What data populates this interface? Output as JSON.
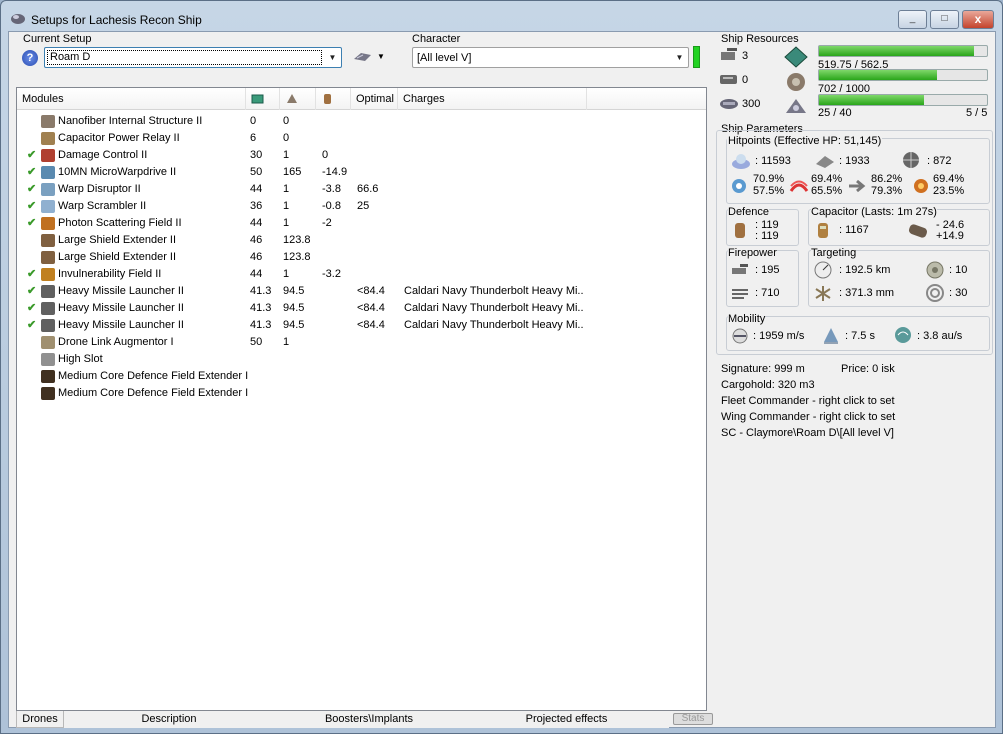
{
  "window": {
    "title": "Setups for Lachesis Recon Ship",
    "min": "_",
    "max": "□",
    "close": "x"
  },
  "setup": {
    "label": "Current Setup",
    "value": "Roam D"
  },
  "character": {
    "label": "Character",
    "value": "[All level V]"
  },
  "modules": {
    "headers": [
      "Modules",
      "Optimal",
      "Charges"
    ],
    "rows": [
      {
        "check": "",
        "name": "Nanofiber Internal Structure II",
        "c1": "0",
        "c2": "0",
        "c3": "",
        "opt": "",
        "charge": "",
        "color": "#8a7a6a"
      },
      {
        "check": "",
        "name": "Capacitor Power Relay II",
        "c1": "6",
        "c2": "0",
        "c3": "",
        "opt": "",
        "charge": "",
        "color": "#a08050"
      },
      {
        "check": "✔",
        "name": "Damage Control II",
        "c1": "30",
        "c2": "1",
        "c3": "0",
        "opt": "",
        "charge": "",
        "color": "#b04030"
      },
      {
        "check": "✔",
        "name": "10MN MicroWarpdrive II",
        "c1": "50",
        "c2": "165",
        "c3": "-14.9",
        "opt": "",
        "charge": "",
        "color": "#5a8ab0"
      },
      {
        "check": "✔",
        "name": "Warp Disruptor II",
        "c1": "44",
        "c2": "1",
        "c3": "-3.8",
        "opt": "66.6",
        "charge": "",
        "color": "#7aa0c0"
      },
      {
        "check": "✔",
        "name": "Warp Scrambler II",
        "c1": "36",
        "c2": "1",
        "c3": "-0.8",
        "opt": "25",
        "charge": "",
        "color": "#90b0d0"
      },
      {
        "check": "✔",
        "name": "Photon Scattering Field II",
        "c1": "44",
        "c2": "1",
        "c3": "-2",
        "opt": "",
        "charge": "",
        "color": "#c07020"
      },
      {
        "check": "",
        "name": "Large Shield Extender II",
        "c1": "46",
        "c2": "123.8",
        "c3": "",
        "opt": "",
        "charge": "",
        "color": "#806040"
      },
      {
        "check": "",
        "name": "Large Shield Extender II",
        "c1": "46",
        "c2": "123.8",
        "c3": "",
        "opt": "",
        "charge": "",
        "color": "#806040"
      },
      {
        "check": "✔",
        "name": "Invulnerability Field II",
        "c1": "44",
        "c2": "1",
        "c3": "-3.2",
        "opt": "",
        "charge": "",
        "color": "#c08020"
      },
      {
        "check": "✔",
        "name": "Heavy Missile Launcher II",
        "c1": "41.3",
        "c2": "94.5",
        "c3": "",
        "opt": "<84.4",
        "charge": "Caldari Navy Thunderbolt Heavy Mi...",
        "color": "#606060"
      },
      {
        "check": "✔",
        "name": "Heavy Missile Launcher II",
        "c1": "41.3",
        "c2": "94.5",
        "c3": "",
        "opt": "<84.4",
        "charge": "Caldari Navy Thunderbolt Heavy Mi...",
        "color": "#606060"
      },
      {
        "check": "✔",
        "name": "Heavy Missile Launcher II",
        "c1": "41.3",
        "c2": "94.5",
        "c3": "",
        "opt": "<84.4",
        "charge": "Caldari Navy Thunderbolt Heavy Mi...",
        "color": "#606060"
      },
      {
        "check": "",
        "name": "Drone Link Augmentor I",
        "c1": "50",
        "c2": "1",
        "c3": "",
        "opt": "",
        "charge": "",
        "color": "#a09070"
      },
      {
        "check": "",
        "name": "High Slot",
        "c1": "",
        "c2": "",
        "c3": "",
        "opt": "",
        "charge": "",
        "color": "#909090"
      },
      {
        "check": "",
        "name": "Medium Core Defence Field Extender I",
        "c1": "",
        "c2": "",
        "c3": "",
        "opt": "",
        "charge": "",
        "color": "#403020"
      },
      {
        "check": "",
        "name": "Medium Core Defence Field Extender I",
        "c1": "",
        "c2": "",
        "c3": "",
        "opt": "",
        "charge": "",
        "color": "#403020"
      }
    ]
  },
  "tabs": [
    "Drones",
    "Description",
    "Boosters\\Implants",
    "Projected effects",
    "Stats"
  ],
  "resources": {
    "title": "Ship Resources",
    "slots": [
      "3",
      "0",
      "300"
    ],
    "bars": [
      {
        "label": "519.75 / 562.5",
        "fill": 0.924
      },
      {
        "label": "702 / 1000",
        "fill": 0.702
      },
      {
        "label": "25 / 40",
        "right": "5 / 5",
        "fill": 0.625
      }
    ]
  },
  "params": {
    "title": "Ship Parameters",
    "hp_title": "Hitpoints (Effective HP: 51,145)",
    "hp": [
      ": 11593",
      ": 1933",
      ": 872"
    ],
    "resists": [
      [
        "70.9%",
        "57.5%"
      ],
      [
        "69.4%",
        "65.5%"
      ],
      [
        "86.2%",
        "79.3%"
      ],
      [
        "69.4%",
        "23.5%"
      ]
    ],
    "defence": {
      "title": "Defence",
      "a": ": 119",
      "b": ": 119"
    },
    "capacitor": {
      "title": "Capacitor (Lasts: 1m 27s)",
      "val": ": 1167",
      "a": "- 24.6",
      "b": "+14.9"
    },
    "firepower": {
      "title": "Firepower",
      "a": ": 195",
      "b": ": 710"
    },
    "targeting": {
      "title": "Targeting",
      "range": ": 192.5 km",
      "targets": ": 10",
      "sig": ": 371.3 mm",
      "scan": ": 30"
    },
    "mobility": {
      "title": "Mobility",
      "speed": ": 1959 m/s",
      "align": ": 7.5 s",
      "warp": ": 3.8 au/s"
    },
    "info": [
      "Signature: 999 m",
      "Price: 0 isk",
      "Cargohold: 320 m3",
      "Fleet Commander - right click to set",
      "Wing Commander - right click to set",
      "SC - Claymore\\Roam D\\[All level V]"
    ]
  }
}
